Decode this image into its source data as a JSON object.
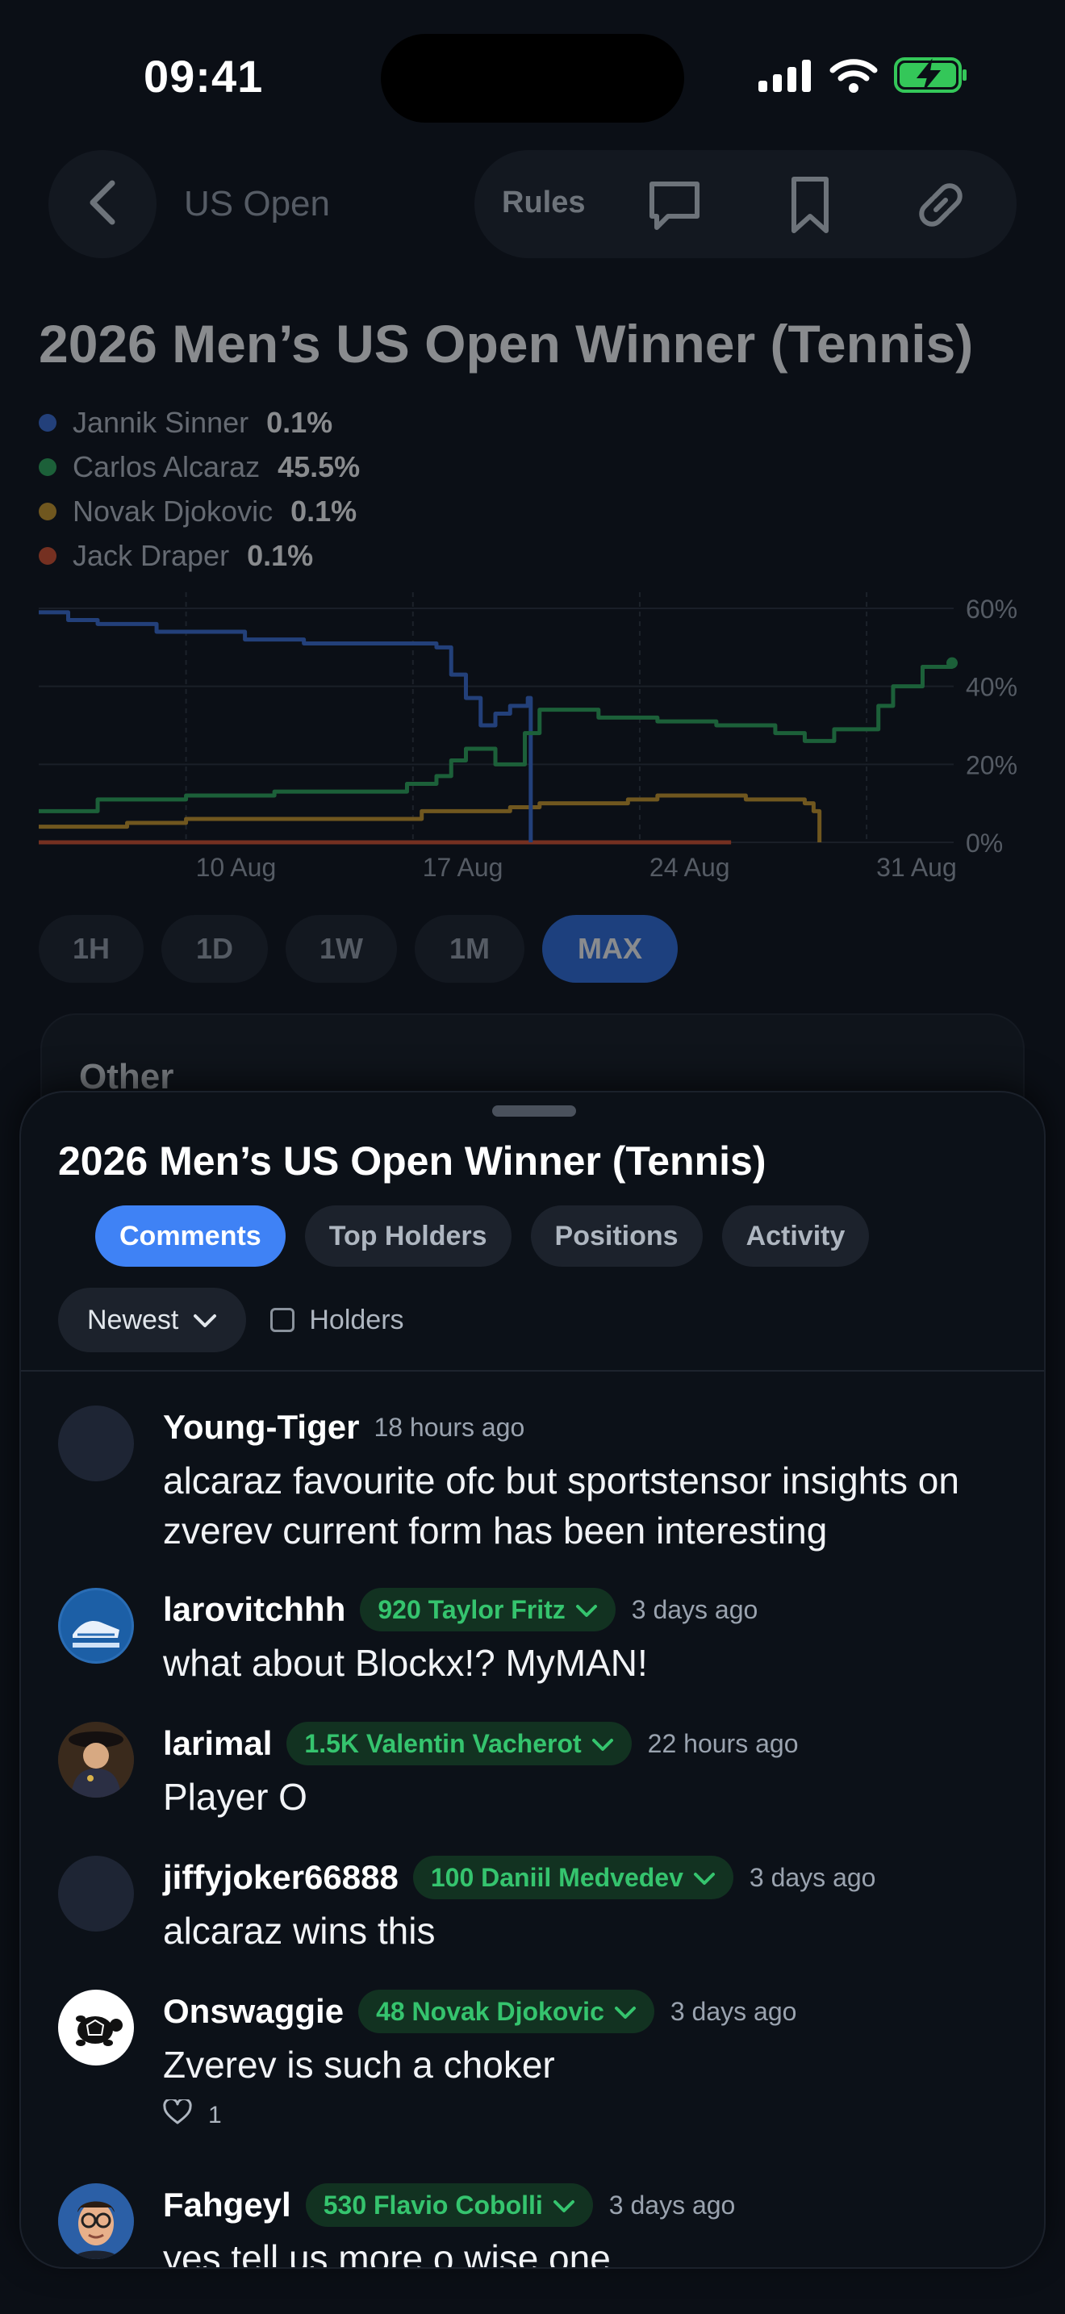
{
  "status_bar": {
    "time": "09:41"
  },
  "nav": {
    "back_icon": "chevron-left-icon",
    "title": "US Open",
    "rules_label": "Rules",
    "icons": [
      "comment-icon",
      "bookmark-icon",
      "link-icon"
    ]
  },
  "market": {
    "title": "2026 Men’s US Open Winner (Tennis)",
    "legend": [
      {
        "name": "Jannik Sinner",
        "pct": "0.1%",
        "color": "#3a6fd8"
      },
      {
        "name": "Carlos Alcaraz",
        "pct": "45.5%",
        "color": "#2eac5c"
      },
      {
        "name": "Novak Djokovic",
        "pct": "0.1%",
        "color": "#cf9a2a"
      },
      {
        "name": "Jack Draper",
        "pct": "0.1%",
        "color": "#d9502d"
      }
    ]
  },
  "chart_data": {
    "type": "line",
    "x_ticks": [
      "10 Aug",
      "17 Aug",
      "24 Aug",
      "31 Aug"
    ],
    "y_ticks": [
      "60%",
      "40%",
      "20%",
      "0%"
    ],
    "ylim": [
      0,
      60
    ],
    "xlim_days": [
      0,
      31
    ],
    "grid": true,
    "series": [
      {
        "name": "Jannik Sinner",
        "color": "#3a6fd8",
        "x": [
          0,
          1,
          2,
          4,
          7,
          9,
          11,
          13,
          13.5,
          14,
          14.5,
          15,
          15.5,
          16,
          16.6,
          16.7
        ],
        "y": [
          59,
          57,
          56,
          54,
          52,
          51,
          51,
          51,
          50,
          43,
          37,
          30,
          33,
          35,
          37,
          0
        ]
      },
      {
        "name": "Carlos Alcaraz",
        "color": "#2eac5c",
        "x": [
          0,
          2,
          5,
          8,
          11,
          12.5,
          13.5,
          14,
          14.5,
          15.5,
          16.5,
          17,
          19,
          21,
          23,
          25,
          26,
          27,
          28.5,
          29,
          30,
          31
        ],
        "y": [
          8,
          11,
          12,
          13,
          13,
          15,
          17,
          21,
          24,
          20,
          28,
          34,
          32,
          31,
          30,
          28,
          26,
          29,
          35,
          40,
          45,
          46
        ]
      },
      {
        "name": "Novak Djokovic",
        "color": "#cf9a2a",
        "x": [
          0,
          3,
          5,
          8,
          11,
          13,
          14,
          15,
          16,
          16.8,
          17,
          19,
          20,
          21,
          22,
          24,
          25,
          26,
          26.3,
          26.5
        ],
        "y": [
          4,
          5,
          6,
          6,
          6,
          8,
          8,
          8,
          9,
          9,
          10,
          10,
          11,
          12,
          12,
          11,
          11,
          10,
          8,
          0
        ]
      },
      {
        "name": "Jack Draper",
        "color": "#d9502d",
        "x": [
          0,
          23.5
        ],
        "y": [
          0,
          0
        ]
      }
    ]
  },
  "range_tabs": [
    {
      "label": "1H",
      "active": false,
      "w": 130
    },
    {
      "label": "1D",
      "active": false,
      "w": 132
    },
    {
      "label": "1W",
      "active": false,
      "w": 138
    },
    {
      "label": "1M",
      "active": false,
      "w": 136
    },
    {
      "label": "MAX",
      "active": true,
      "w": 168
    }
  ],
  "other_card": {
    "title": "Other"
  },
  "sheet": {
    "title": "2026 Men’s US Open Winner (Tennis)",
    "tabs": [
      {
        "label": "Comments",
        "active": true
      },
      {
        "label": "Top Holders",
        "active": false
      },
      {
        "label": "Positions",
        "active": false
      },
      {
        "label": "Activity",
        "active": false
      }
    ],
    "sort_label": "Newest",
    "holders_label": "Holders",
    "comments": [
      {
        "user": "Young-Tiger",
        "badge": "",
        "time": "18 hours ago",
        "body": "alcaraz favourite ofc but sportstensor insights on zverev current form has been interesting",
        "likes": "",
        "avatar": "blank"
      },
      {
        "user": "larovitchhh",
        "badge": "920 Taylor Fritz",
        "time": "3 days ago",
        "body": "what about Blockx!? MyMAN!",
        "likes": "",
        "avatar": "shoe"
      },
      {
        "user": "larimal",
        "badge": "1.5K Valentin Vacherot",
        "time": "22 hours ago",
        "body": "Player O",
        "likes": "",
        "avatar": "portrait"
      },
      {
        "user": "jiffyjoker66888",
        "badge": "100 Daniil Medvedev",
        "time": "3 days ago",
        "body": "alcaraz wins this",
        "likes": "",
        "avatar": "blank"
      },
      {
        "user": "Onswaggie",
        "badge": "48 Novak Djokovic",
        "time": "3 days ago",
        "body": "Zverev is such a choker",
        "likes": "1",
        "avatar": "turtle"
      },
      {
        "user": "Fahgeyl",
        "badge": "530 Flavio Cobolli",
        "time": "3 days ago",
        "body": "yes tell us more o wise one",
        "likes": "",
        "avatar": "cartoon"
      }
    ]
  }
}
